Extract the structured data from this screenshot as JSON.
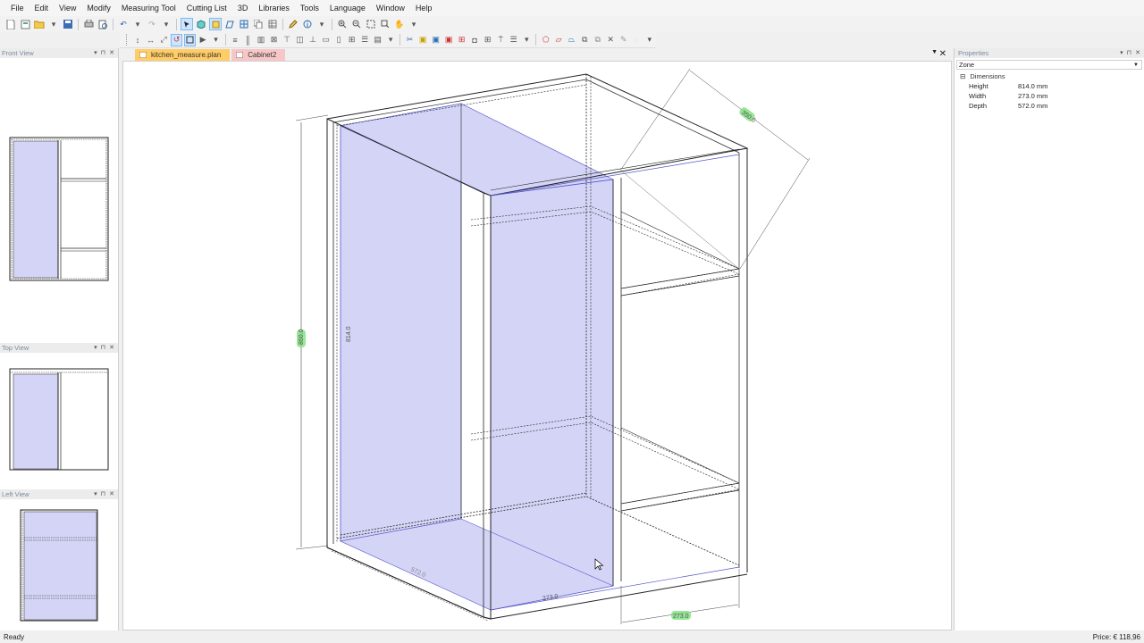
{
  "menu": [
    "File",
    "Edit",
    "View",
    "Modify",
    "Measuring Tool",
    "Cutting List",
    "3D",
    "Libraries",
    "Tools",
    "Language",
    "Window",
    "Help"
  ],
  "panels": {
    "front": {
      "title": "Front View"
    },
    "top": {
      "title": "Top View"
    },
    "left": {
      "title": "Left View"
    }
  },
  "tabs": [
    {
      "label": "kitchen_measure.plan",
      "state": "active"
    },
    {
      "label": "Cabinet2",
      "state": "inactive"
    }
  ],
  "properties": {
    "title": "Properties",
    "selected": "Zone",
    "group": "Dimensions",
    "rows": [
      {
        "key": "Height",
        "value": "814.0 mm"
      },
      {
        "key": "Width",
        "value": "273.0 mm"
      },
      {
        "key": "Depth",
        "value": "572.0 mm"
      }
    ]
  },
  "dimensions": {
    "outer_height": "850.0",
    "inner_height": "814.0",
    "diagonal": "350.0",
    "depth": "572.0",
    "inner_width": "273.0",
    "width": "273.0"
  },
  "status": {
    "left": "Ready",
    "right": "Price: € 118,96"
  },
  "colors": {
    "zone_fill": "#d4d4f6",
    "active_tab": "#ffcc66",
    "inactive_tab": "#f7c7c7",
    "dim_highlight": "#7ee07e"
  }
}
